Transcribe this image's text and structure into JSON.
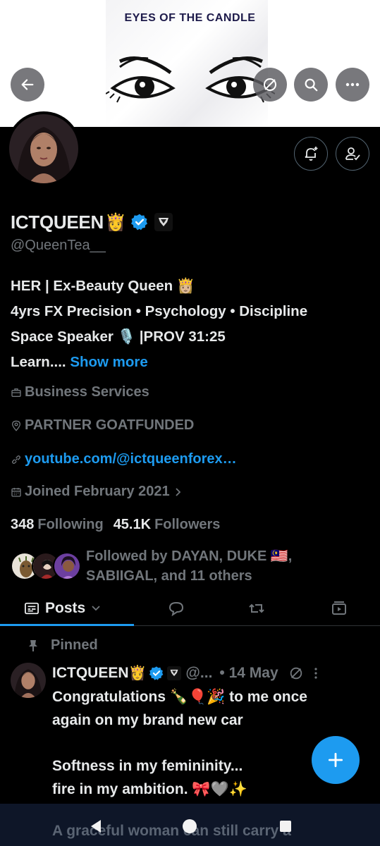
{
  "banner": {
    "title": "EYES OF THE CANDLE"
  },
  "top_actions": {
    "back": "back-arrow-icon",
    "hide": "eye-off-icon",
    "search": "search-icon",
    "more": "more-icon"
  },
  "profile": {
    "name": "ICTQUEEN",
    "name_emoji": "👸",
    "handle": "@QueenTea__",
    "bio_lines": [
      "HER | Ex-Beauty Queen 👸🏼",
      "4yrs FX Precision • Psychology • Discipline",
      "Space Speaker 🎙️ |PROV 31:25"
    ],
    "bio_truncated": "Learn....",
    "show_more": "Show more",
    "category": "Business Services",
    "location": "PARTNER GOATFUNDED",
    "website": "youtube.com/@ictqueenforex…",
    "joined": "Joined February 2021",
    "following_count": "348",
    "following_label": "Following",
    "followers_count": "45.1K",
    "followers_label": "Followers",
    "followed_by_line1": "Followed by DAYAN, DUKE 🇲🇾,",
    "followed_by_line2": "SABIIGAL, and 11 others"
  },
  "tabs": {
    "posts": "Posts"
  },
  "post": {
    "pinned_label": "Pinned",
    "name": "ICTQUEEN",
    "name_emoji": "👸",
    "handle": "@...",
    "date": "• 14 May",
    "body_lines": [
      "Congratulations 🍾🎈🎉 to me once",
      "again on my brand new car",
      "",
      "Softness in my femininity...",
      "fire in my ambition. 🎀🩶✨",
      "",
      "A graceful woman can still carry a"
    ]
  },
  "colors": {
    "accent": "#1d9bf0",
    "muted": "#71767b",
    "text": "#e7e9ea",
    "background": "#000000",
    "verified": "#1d9bf0"
  }
}
